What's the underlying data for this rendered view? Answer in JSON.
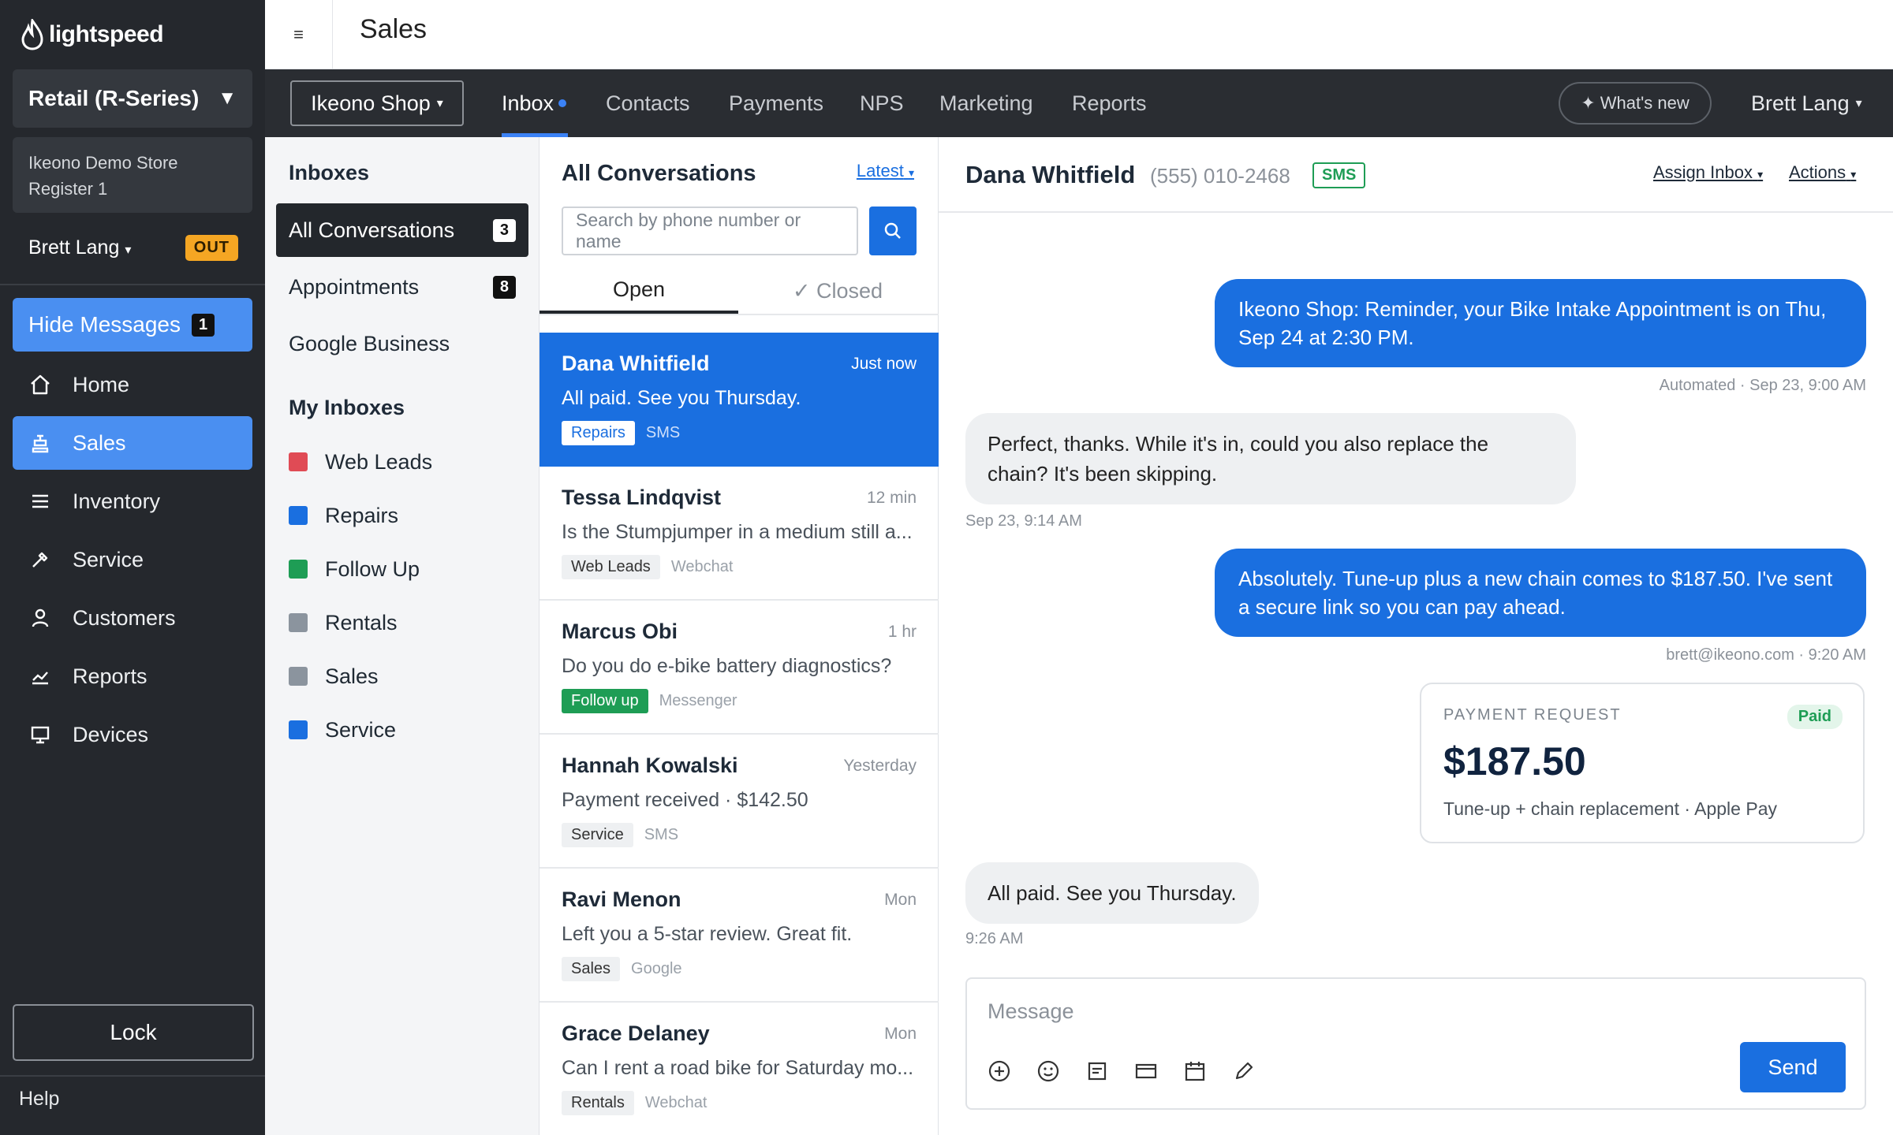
{
  "brand": {
    "logo_text": "lightspeed"
  },
  "sidebar": {
    "retail_label": "Retail (R-Series)",
    "retail_caret": "▼",
    "store_name": "Ikeono Demo Store",
    "register": "Register 1",
    "user": "Brett Lang",
    "status_badge": "OUT",
    "hide_messages_label": "Hide Messages",
    "hide_messages_count": "1",
    "nav": [
      {
        "label": "Home",
        "icon": "home-icon"
      },
      {
        "label": "Sales",
        "icon": "register-icon"
      },
      {
        "label": "Inventory",
        "icon": "list-icon"
      },
      {
        "label": "Service",
        "icon": "wrench-icon"
      },
      {
        "label": "Customers",
        "icon": "user-icon"
      },
      {
        "label": "Reports",
        "icon": "chart-icon"
      },
      {
        "label": "Devices",
        "icon": "monitor-icon"
      }
    ],
    "active_nav": "Sales",
    "lock_label": "Lock",
    "help_label": "Help"
  },
  "topbar": {
    "menu_glyph": "≡",
    "page_title": "Sales"
  },
  "appnav": {
    "shop_label": "Ikeono Shop",
    "tabs": [
      "Inbox",
      "Contacts",
      "Payments",
      "NPS",
      "Marketing",
      "Reports"
    ],
    "active_tab": "Inbox",
    "whats_new": "✦ What's new",
    "user": "Brett Lang"
  },
  "inboxes": {
    "heading": "Inboxes",
    "items": [
      {
        "label": "All Conversations",
        "count": "3"
      },
      {
        "label": "Appointments",
        "count": "8"
      },
      {
        "label": "Google Business",
        "count": ""
      }
    ],
    "my_heading": "My Inboxes",
    "my_items": [
      {
        "label": "Web Leads",
        "color": "#e04b55"
      },
      {
        "label": "Repairs",
        "color": "#1a6fe0"
      },
      {
        "label": "Follow Up",
        "color": "#1e9d55"
      },
      {
        "label": "Rentals",
        "color": "#8b949e"
      },
      {
        "label": "Sales",
        "color": "#8b949e"
      },
      {
        "label": "Service",
        "color": "#1a6fe0"
      }
    ]
  },
  "conversations": {
    "title": "All Conversations",
    "sort_label": "Latest",
    "search_placeholder": "Search by phone number or name",
    "tabs": {
      "open": "Open",
      "closed": "✓ Closed"
    },
    "list": [
      {
        "name": "Dana Whitfield",
        "time": "Just now",
        "preview": "All paid. See you Thursday.",
        "tag": "Repairs",
        "channel": "SMS"
      },
      {
        "name": "Tessa Lindqvist",
        "time": "12 min",
        "preview": "Is the Stumpjumper in a medium still a...",
        "tag": "Web Leads",
        "channel": "Webchat"
      },
      {
        "name": "Marcus Obi",
        "time": "1 hr",
        "preview": "Do you do e-bike battery diagnostics?",
        "tag": "Follow up",
        "channel": "Messenger"
      },
      {
        "name": "Hannah Kowalski",
        "time": "Yesterday",
        "preview": "Payment received · $142.50",
        "tag": "Service",
        "channel": "SMS"
      },
      {
        "name": "Ravi Menon",
        "time": "Mon",
        "preview": "Left you a 5-star review. Great fit.",
        "tag": "Sales",
        "channel": "Google"
      },
      {
        "name": "Grace Delaney",
        "time": "Mon",
        "preview": "Can I rent a road bike for Saturday mo...",
        "tag": "Rentals",
        "channel": "Webchat"
      }
    ]
  },
  "chat": {
    "contact_name": "Dana Whitfield",
    "phone": "(555) 010-2468",
    "channel_badge": "SMS",
    "assign_label": "Assign Inbox",
    "actions_label": "Actions",
    "messages": [
      {
        "text": "Ikeono Shop: Reminder, your Bike Intake Appointment is on Thu, Sep 24 at 2:30 PM.",
        "meta": "Automated · Sep 23, 9:00 AM"
      },
      {
        "text": "Perfect, thanks. While it's in, could you also replace the chain? It's been skipping.",
        "meta": "Sep 23, 9:14 AM"
      },
      {
        "text": "Absolutely. Tune-up plus a new chain comes to $187.50. I've sent a secure link so you can pay ahead.",
        "meta": "brett@ikeono.com · 9:20 AM"
      },
      {
        "text": "All paid. See you Thursday.",
        "meta": "9:26 AM"
      }
    ],
    "payment": {
      "label": "PAYMENT REQUEST",
      "status": "Paid",
      "amount": "$187.50",
      "description": "Tune-up + chain replacement · Apple Pay"
    },
    "composer_placeholder": "Message",
    "send_label": "Send"
  }
}
